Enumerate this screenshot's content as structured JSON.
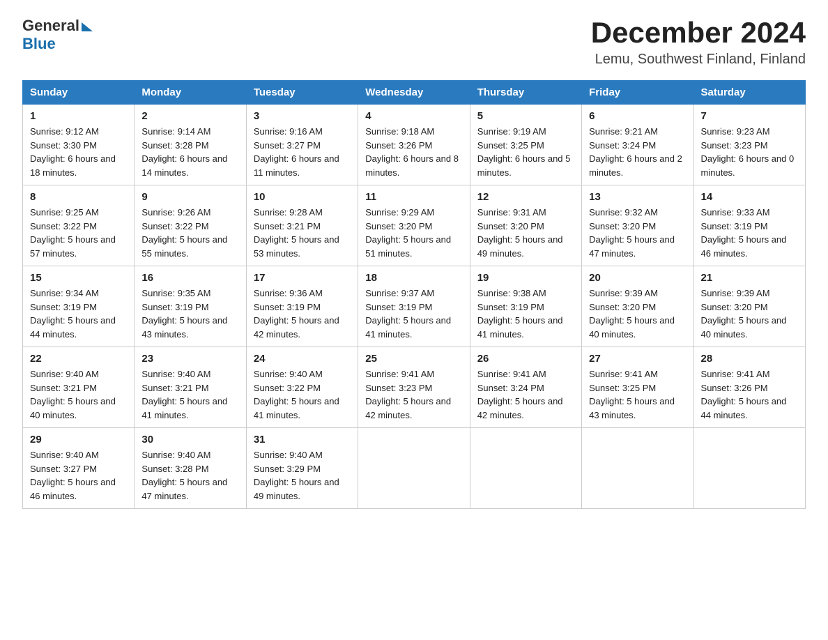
{
  "header": {
    "logo_general": "General",
    "logo_blue": "Blue",
    "month": "December 2024",
    "location": "Lemu, Southwest Finland, Finland"
  },
  "weekdays": [
    "Sunday",
    "Monday",
    "Tuesday",
    "Wednesday",
    "Thursday",
    "Friday",
    "Saturday"
  ],
  "weeks": [
    [
      {
        "day": "1",
        "sunrise": "9:12 AM",
        "sunset": "3:30 PM",
        "daylight": "6 hours and 18 minutes."
      },
      {
        "day": "2",
        "sunrise": "9:14 AM",
        "sunset": "3:28 PM",
        "daylight": "6 hours and 14 minutes."
      },
      {
        "day": "3",
        "sunrise": "9:16 AM",
        "sunset": "3:27 PM",
        "daylight": "6 hours and 11 minutes."
      },
      {
        "day": "4",
        "sunrise": "9:18 AM",
        "sunset": "3:26 PM",
        "daylight": "6 hours and 8 minutes."
      },
      {
        "day": "5",
        "sunrise": "9:19 AM",
        "sunset": "3:25 PM",
        "daylight": "6 hours and 5 minutes."
      },
      {
        "day": "6",
        "sunrise": "9:21 AM",
        "sunset": "3:24 PM",
        "daylight": "6 hours and 2 minutes."
      },
      {
        "day": "7",
        "sunrise": "9:23 AM",
        "sunset": "3:23 PM",
        "daylight": "6 hours and 0 minutes."
      }
    ],
    [
      {
        "day": "8",
        "sunrise": "9:25 AM",
        "sunset": "3:22 PM",
        "daylight": "5 hours and 57 minutes."
      },
      {
        "day": "9",
        "sunrise": "9:26 AM",
        "sunset": "3:22 PM",
        "daylight": "5 hours and 55 minutes."
      },
      {
        "day": "10",
        "sunrise": "9:28 AM",
        "sunset": "3:21 PM",
        "daylight": "5 hours and 53 minutes."
      },
      {
        "day": "11",
        "sunrise": "9:29 AM",
        "sunset": "3:20 PM",
        "daylight": "5 hours and 51 minutes."
      },
      {
        "day": "12",
        "sunrise": "9:31 AM",
        "sunset": "3:20 PM",
        "daylight": "5 hours and 49 minutes."
      },
      {
        "day": "13",
        "sunrise": "9:32 AM",
        "sunset": "3:20 PM",
        "daylight": "5 hours and 47 minutes."
      },
      {
        "day": "14",
        "sunrise": "9:33 AM",
        "sunset": "3:19 PM",
        "daylight": "5 hours and 46 minutes."
      }
    ],
    [
      {
        "day": "15",
        "sunrise": "9:34 AM",
        "sunset": "3:19 PM",
        "daylight": "5 hours and 44 minutes."
      },
      {
        "day": "16",
        "sunrise": "9:35 AM",
        "sunset": "3:19 PM",
        "daylight": "5 hours and 43 minutes."
      },
      {
        "day": "17",
        "sunrise": "9:36 AM",
        "sunset": "3:19 PM",
        "daylight": "5 hours and 42 minutes."
      },
      {
        "day": "18",
        "sunrise": "9:37 AM",
        "sunset": "3:19 PM",
        "daylight": "5 hours and 41 minutes."
      },
      {
        "day": "19",
        "sunrise": "9:38 AM",
        "sunset": "3:19 PM",
        "daylight": "5 hours and 41 minutes."
      },
      {
        "day": "20",
        "sunrise": "9:39 AM",
        "sunset": "3:20 PM",
        "daylight": "5 hours and 40 minutes."
      },
      {
        "day": "21",
        "sunrise": "9:39 AM",
        "sunset": "3:20 PM",
        "daylight": "5 hours and 40 minutes."
      }
    ],
    [
      {
        "day": "22",
        "sunrise": "9:40 AM",
        "sunset": "3:21 PM",
        "daylight": "5 hours and 40 minutes."
      },
      {
        "day": "23",
        "sunrise": "9:40 AM",
        "sunset": "3:21 PM",
        "daylight": "5 hours and 41 minutes."
      },
      {
        "day": "24",
        "sunrise": "9:40 AM",
        "sunset": "3:22 PM",
        "daylight": "5 hours and 41 minutes."
      },
      {
        "day": "25",
        "sunrise": "9:41 AM",
        "sunset": "3:23 PM",
        "daylight": "5 hours and 42 minutes."
      },
      {
        "day": "26",
        "sunrise": "9:41 AM",
        "sunset": "3:24 PM",
        "daylight": "5 hours and 42 minutes."
      },
      {
        "day": "27",
        "sunrise": "9:41 AM",
        "sunset": "3:25 PM",
        "daylight": "5 hours and 43 minutes."
      },
      {
        "day": "28",
        "sunrise": "9:41 AM",
        "sunset": "3:26 PM",
        "daylight": "5 hours and 44 minutes."
      }
    ],
    [
      {
        "day": "29",
        "sunrise": "9:40 AM",
        "sunset": "3:27 PM",
        "daylight": "5 hours and 46 minutes."
      },
      {
        "day": "30",
        "sunrise": "9:40 AM",
        "sunset": "3:28 PM",
        "daylight": "5 hours and 47 minutes."
      },
      {
        "day": "31",
        "sunrise": "9:40 AM",
        "sunset": "3:29 PM",
        "daylight": "5 hours and 49 minutes."
      },
      null,
      null,
      null,
      null
    ]
  ]
}
